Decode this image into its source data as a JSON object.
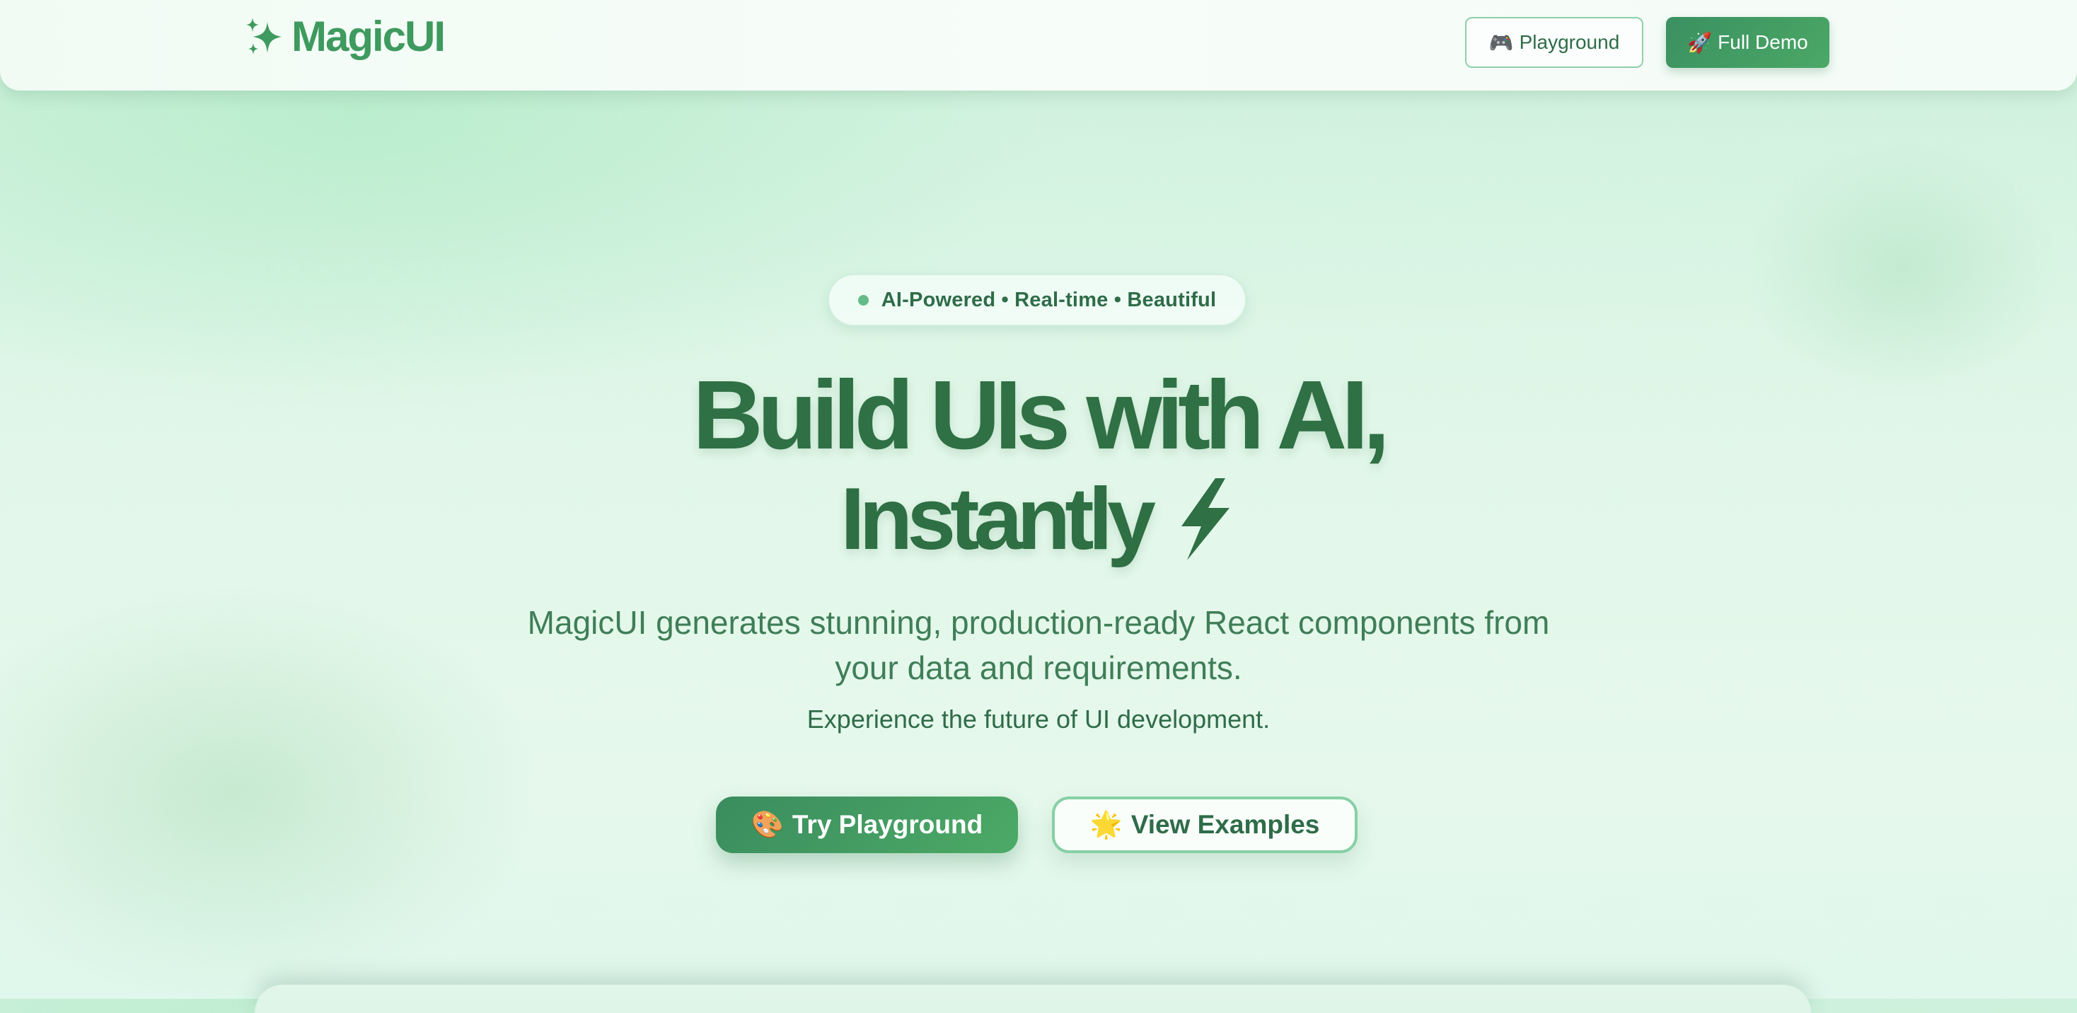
{
  "header": {
    "brand": {
      "icon": "sparkles-icon",
      "name": "MagicUI",
      "color": "#3e9a5e"
    },
    "nav": {
      "playground": {
        "icon": "🎮",
        "label": "Playground"
      },
      "full_demo": {
        "icon": "🚀",
        "label": "Full Demo"
      }
    }
  },
  "hero": {
    "badge": "AI-Powered • Real-time • Beautiful",
    "headline_line1": "Build UIs with AI,",
    "headline_line2": "Instantly",
    "headline_icon": "lightning-bolt-icon",
    "subtitle_line1": "MagicUI generates stunning, production-ready React components from",
    "subtitle_line2": "your data and requirements.",
    "tagline": "Experience the future of UI development.",
    "cta_primary": {
      "icon": "🎨",
      "label": "Try Playground"
    },
    "cta_secondary": {
      "icon": "🌟",
      "label": "View Examples"
    }
  },
  "colors": {
    "accent": "#3e9a5e",
    "headline": "#2f7044",
    "text": "#2f6c49",
    "background": "#e2f7e9"
  }
}
